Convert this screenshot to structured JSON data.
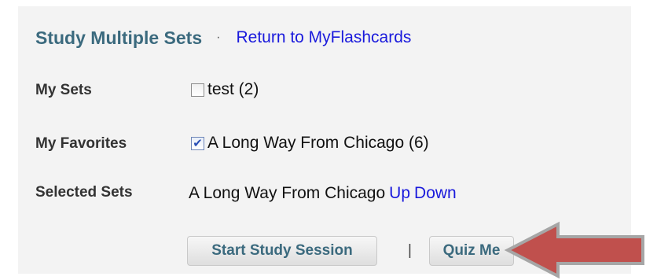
{
  "header": {
    "title": "Study Multiple Sets",
    "separator": "·",
    "return_link": "Return to MyFlashcards"
  },
  "my_sets": {
    "label": "My Sets",
    "items": [
      {
        "name": "test (2)",
        "checked": false
      }
    ]
  },
  "my_favorites": {
    "label": "My Favorites",
    "items": [
      {
        "name": "A Long Way From Chicago (6)",
        "checked": true,
        "check_glyph": "✔"
      }
    ]
  },
  "selected_sets": {
    "label": "Selected Sets",
    "items": [
      {
        "name": "A Long Way From Chicago",
        "up_label": "Up",
        "down_label": "Down"
      }
    ]
  },
  "actions": {
    "start_label": "Start Study Session",
    "divider": "|",
    "quiz_label": "Quiz Me"
  },
  "colors": {
    "title": "#3b6a7e",
    "link": "#1a1adc",
    "panel_background": "#f3f3f3",
    "arrow_fill": "#c0504d",
    "arrow_stroke": "#a6a6a6"
  },
  "annotation": {
    "icon": "left-arrow-icon"
  }
}
